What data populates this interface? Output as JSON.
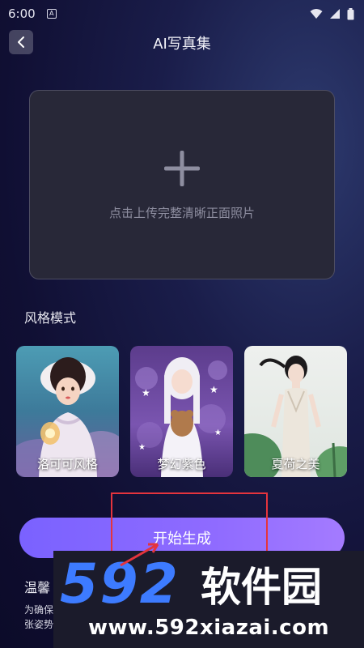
{
  "status_bar": {
    "time": "6:00",
    "sim_label": "A"
  },
  "header": {
    "title": "AI写真集"
  },
  "upload": {
    "hint": "点击上传完整清晰正面照片"
  },
  "styles": {
    "title": "风格模式",
    "items": [
      {
        "label": "洛可可风格"
      },
      {
        "label": "梦幻紫色"
      },
      {
        "label": "夏荷之美"
      }
    ]
  },
  "actions": {
    "start_label": "开始生成"
  },
  "tips": {
    "title": "温馨",
    "line1": "为确保",
    "line2": "张姿势"
  },
  "watermark": {
    "brand": "592软件园",
    "url": "www.592xiazai.com"
  },
  "colors": {
    "accent": "#8f6bff",
    "highlight_frame": "#e5343d",
    "watermark_blue": "#3d7bff"
  }
}
